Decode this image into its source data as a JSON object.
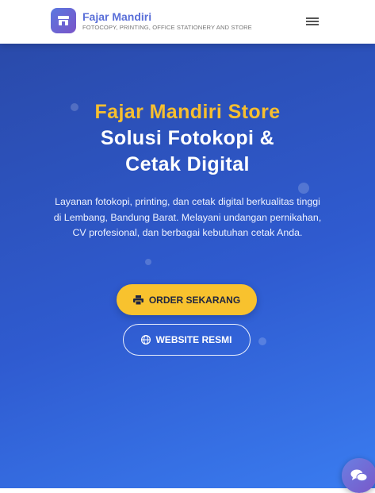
{
  "header": {
    "brand_name": "Fajar Mandiri",
    "brand_tagline": "FOTOCOPY, PRINTING, OFFICE STATIONERY AND STORE",
    "logo_icon": "store-icon",
    "menu_icon": "hamburger-menu-icon"
  },
  "hero": {
    "title_line1": "Fajar Mandiri Store",
    "title_line2": "Solusi Fotokopi &",
    "title_line3": "Cetak Digital",
    "description": "Layanan fotokopi, printing, dan cetak digital berkualitas tinggi di Lembang, Bandung Barat. Melayani undangan pernikahan, CV profesional, dan berbagai kebutuhan cetak Anda.",
    "order_button": {
      "label": "ORDER SEKARANG",
      "icon": "printer-icon"
    },
    "website_button": {
      "label": "WEBSITE RESMI",
      "icon": "globe-icon"
    }
  },
  "chat": {
    "icon": "chat-icon"
  },
  "colors": {
    "header_bg": "#ffffff",
    "brand": "#5a6fd8",
    "hero_bg_start": "#2a4aaa",
    "hero_bg_end": "#3a7cf0",
    "accent": "#f8c22e"
  }
}
